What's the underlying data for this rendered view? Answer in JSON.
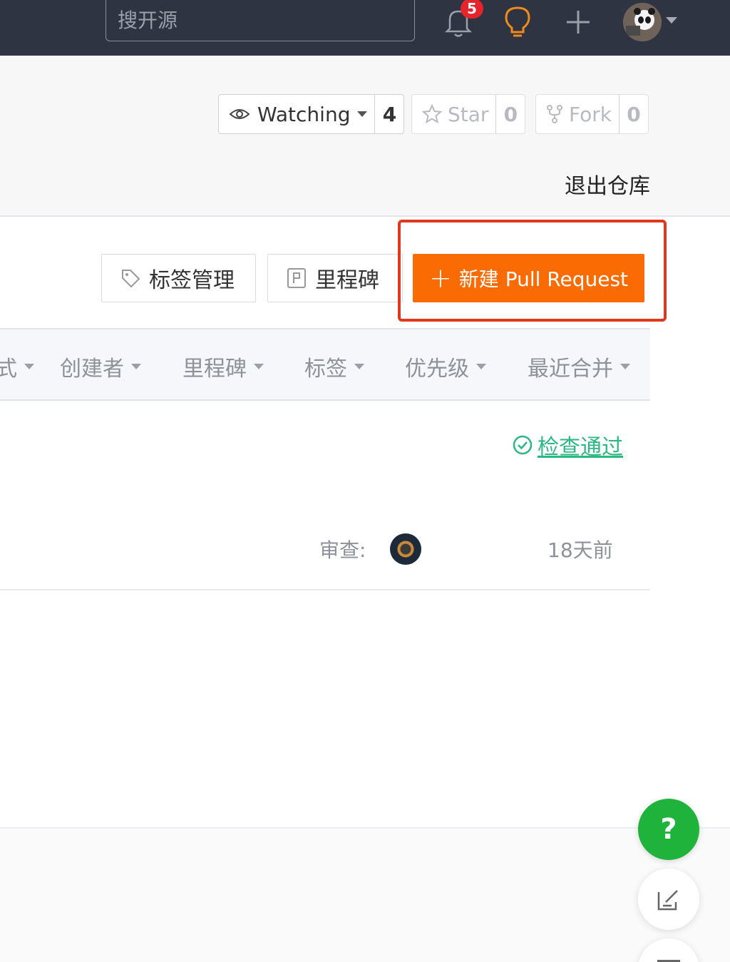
{
  "topbar": {
    "search_placeholder": "搜开源",
    "notification_count": "5",
    "icons": [
      "bell-icon",
      "lightbulb-icon",
      "plus-icon",
      "avatar"
    ]
  },
  "repo_actions": {
    "watch": {
      "label": "Watching",
      "count": "4"
    },
    "star": {
      "label": "Star",
      "count": "0"
    },
    "fork": {
      "label": "Fork",
      "count": "0"
    },
    "exit_label": "退出仓库"
  },
  "toolbar": {
    "labels_button": "标签管理",
    "milestones_button": "里程碑",
    "new_pr_button": "新建 Pull Request"
  },
  "filters": [
    "式",
    "创建者",
    "里程碑",
    "标签",
    "优先级",
    "最近合并"
  ],
  "pull_request_row": {
    "check_status": "检查通过",
    "review_label": "审查:",
    "time_ago": "18天前"
  },
  "floating": {
    "help_label": "?"
  },
  "colors": {
    "topbar": "#2f3442",
    "accent": "#fb6b03",
    "success": "#2db782",
    "help": "#1fb33b",
    "highlight": "#e2371f"
  }
}
